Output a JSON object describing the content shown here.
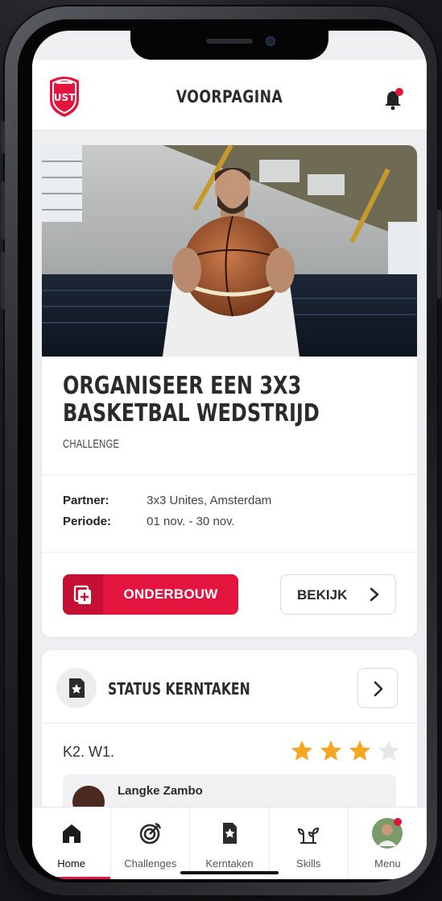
{
  "header": {
    "title": "VOORPAGINA",
    "logo_text": "UST",
    "has_notification": true
  },
  "challenge": {
    "title_line1": "ORGANISEER EEN 3X3",
    "title_line2": "BASKETBAL WEDSTRIJD",
    "type": "CHALLENGE",
    "partner_label": "Partner:",
    "partner_value": "3x3 Unites, Amsterdam",
    "period_label": "Periode:",
    "period_value": "01 nov. - 30 nov.",
    "primary_button": "ONDERBOUW",
    "secondary_button": "BEKIJK",
    "image_icon": "basketball-player-photo"
  },
  "status": {
    "title": "STATUS KERNTAKEN",
    "task_code": "K2. W1.",
    "rating": 3,
    "rating_max": 4,
    "person_name": "Langke Zambo"
  },
  "nav": {
    "items": [
      {
        "label": "Home",
        "icon": "home-icon",
        "active": true
      },
      {
        "label": "Challenges",
        "icon": "target-icon",
        "active": false
      },
      {
        "label": "Kerntaken",
        "icon": "document-icon",
        "active": false
      },
      {
        "label": "Skills",
        "icon": "sprout-icon",
        "active": false
      },
      {
        "label": "Menu",
        "icon": "avatar",
        "active": false
      }
    ]
  },
  "colors": {
    "accent": "#e3153e",
    "star": "#f5a623",
    "star_empty": "#e6e7ea"
  }
}
